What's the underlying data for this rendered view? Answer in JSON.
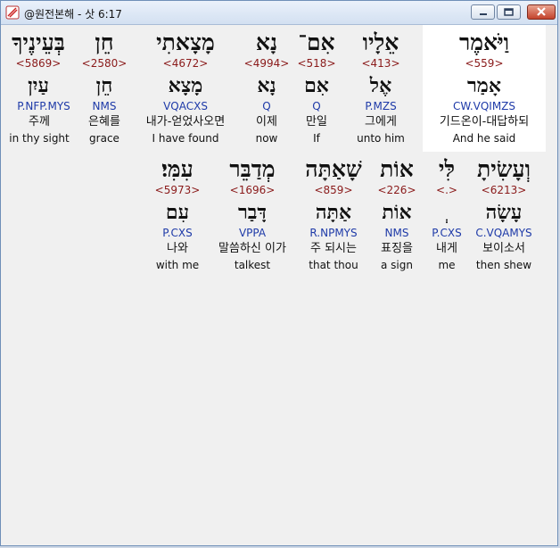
{
  "window": {
    "title": "@원전본해 - 삿 6:17"
  },
  "rows": [
    {
      "words": [
        {
          "hebrew": "וַיֹּאמֶר",
          "strong": "<559>",
          "lemma": "אָמַר",
          "morph": "CW.VQIMZS",
          "korean": "기드온이-대답하되",
          "english": "And he said",
          "selected": true
        },
        {
          "hebrew": "אֵלָיו",
          "strong": "<413>",
          "lemma": "אֶל",
          "morph": "P.MZS",
          "korean": "그에게",
          "english": "unto him",
          "selected": false
        },
        {
          "hebrew": "אִם־",
          "strong": "<518>",
          "lemma": "אִם",
          "morph": "Q",
          "korean": "만일",
          "english": "If",
          "selected": false
        },
        {
          "hebrew": "נָא",
          "strong": "<4994>",
          "lemma": "נָא",
          "morph": "Q",
          "korean": "이제",
          "english": "now",
          "selected": false
        },
        {
          "hebrew": "מָצָאתִי",
          "strong": "<4672>",
          "lemma": "מָצָא",
          "morph": "VQACXS",
          "korean": "내가-얻었사오면",
          "english": "I have found",
          "selected": false
        },
        {
          "hebrew": "חֵן",
          "strong": "<2580>",
          "lemma": "חֵן",
          "morph": "NMS",
          "korean": "은혜를",
          "english": "grace",
          "selected": false
        },
        {
          "hebrew": "בְּעֵינֶיךָ",
          "strong": "<5869>",
          "lemma": "עַיִן",
          "morph": "P.NFP.MYS",
          "korean": "주께",
          "english": "in thy sight",
          "selected": false
        }
      ]
    },
    {
      "words": [
        {
          "hebrew": "וְעָשִׂיתָ",
          "strong": "<6213>",
          "lemma": "עָשָׂה",
          "morph": "C.VQAMYS",
          "korean": "보이소서",
          "english": "then shew",
          "selected": false
        },
        {
          "hebrew": "לִּי",
          "strong": "<.>",
          "lemma": "ְ",
          "morph": "P.CXS",
          "korean": "내게",
          "english": "me",
          "selected": false
        },
        {
          "hebrew": "אוֹת",
          "strong": "<226>",
          "lemma": "אוֹת",
          "morph": "NMS",
          "korean": "표징을",
          "english": "a sign",
          "selected": false
        },
        {
          "hebrew": "שָׁאַתָּה",
          "strong": "<859>",
          "lemma": "אַתָּה",
          "morph": "R.NPMYS",
          "korean": "주 되시는",
          "english": "that thou",
          "selected": false
        },
        {
          "hebrew": "מְדַבֵּר",
          "strong": "<1696>",
          "lemma": "דָּבַר",
          "morph": "VPPA",
          "korean": "말씀하신 이가",
          "english": "talkest",
          "selected": false
        },
        {
          "hebrew": "עִמִּי׃",
          "strong": "<5973>",
          "lemma": "עִם",
          "morph": "P.CXS",
          "korean": "나와",
          "english": "with me",
          "selected": false
        }
      ]
    }
  ]
}
